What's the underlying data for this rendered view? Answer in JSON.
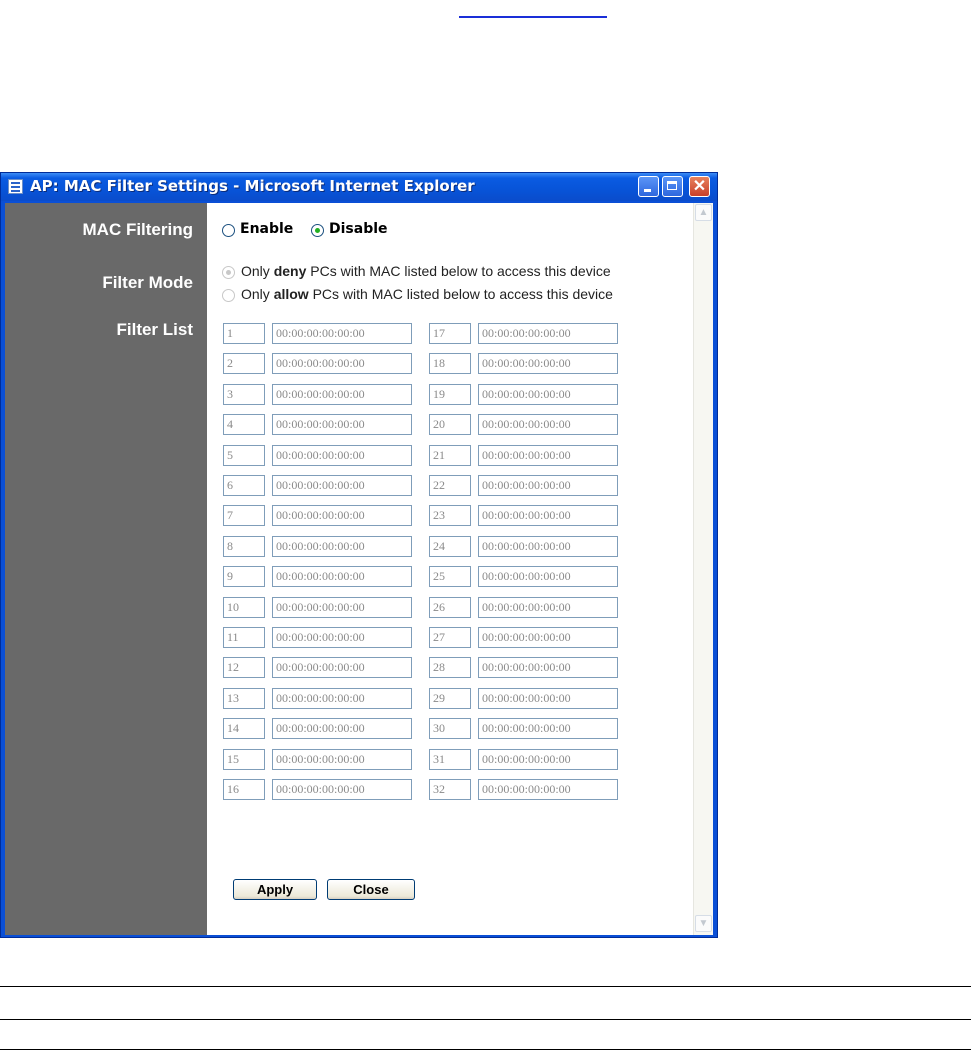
{
  "window": {
    "title": "AP: MAC Filter Settings - Microsoft Internet Explorer",
    "minimize_glyph": "",
    "close_glyph": "✕"
  },
  "labels": {
    "mac_filtering": "MAC Filtering",
    "filter_mode": "Filter Mode",
    "filter_list": "Filter List"
  },
  "mac_filtering": {
    "enable_label": "Enable",
    "disable_label": "Disable",
    "selected": "Disable"
  },
  "filter_mode": {
    "option1_prefix": "Only ",
    "option1_bold": "deny",
    "option1_suffix": " PCs with MAC listed below to access this device",
    "option2_prefix": "Only ",
    "option2_bold": "allow",
    "option2_suffix": " PCs with MAC listed below to access this device",
    "selected": "deny",
    "disabled": true
  },
  "filter_list": [
    {
      "index": "1",
      "mac": "00:00:00:00:00:00"
    },
    {
      "index": "2",
      "mac": "00:00:00:00:00:00"
    },
    {
      "index": "3",
      "mac": "00:00:00:00:00:00"
    },
    {
      "index": "4",
      "mac": "00:00:00:00:00:00"
    },
    {
      "index": "5",
      "mac": "00:00:00:00:00:00"
    },
    {
      "index": "6",
      "mac": "00:00:00:00:00:00"
    },
    {
      "index": "7",
      "mac": "00:00:00:00:00:00"
    },
    {
      "index": "8",
      "mac": "00:00:00:00:00:00"
    },
    {
      "index": "9",
      "mac": "00:00:00:00:00:00"
    },
    {
      "index": "10",
      "mac": "00:00:00:00:00:00"
    },
    {
      "index": "11",
      "mac": "00:00:00:00:00:00"
    },
    {
      "index": "12",
      "mac": "00:00:00:00:00:00"
    },
    {
      "index": "13",
      "mac": "00:00:00:00:00:00"
    },
    {
      "index": "14",
      "mac": "00:00:00:00:00:00"
    },
    {
      "index": "15",
      "mac": "00:00:00:00:00:00"
    },
    {
      "index": "16",
      "mac": "00:00:00:00:00:00"
    },
    {
      "index": "17",
      "mac": "00:00:00:00:00:00"
    },
    {
      "index": "18",
      "mac": "00:00:00:00:00:00"
    },
    {
      "index": "19",
      "mac": "00:00:00:00:00:00"
    },
    {
      "index": "20",
      "mac": "00:00:00:00:00:00"
    },
    {
      "index": "21",
      "mac": "00:00:00:00:00:00"
    },
    {
      "index": "22",
      "mac": "00:00:00:00:00:00"
    },
    {
      "index": "23",
      "mac": "00:00:00:00:00:00"
    },
    {
      "index": "24",
      "mac": "00:00:00:00:00:00"
    },
    {
      "index": "25",
      "mac": "00:00:00:00:00:00"
    },
    {
      "index": "26",
      "mac": "00:00:00:00:00:00"
    },
    {
      "index": "27",
      "mac": "00:00:00:00:00:00"
    },
    {
      "index": "28",
      "mac": "00:00:00:00:00:00"
    },
    {
      "index": "29",
      "mac": "00:00:00:00:00:00"
    },
    {
      "index": "30",
      "mac": "00:00:00:00:00:00"
    },
    {
      "index": "31",
      "mac": "00:00:00:00:00:00"
    },
    {
      "index": "32",
      "mac": "00:00:00:00:00:00"
    }
  ],
  "buttons": {
    "apply": "Apply",
    "close": "Close"
  },
  "colors": {
    "titlebar": "#0a5be2",
    "sidebar": "#696969",
    "field_border": "#7f9db9",
    "field_text": "#8a8a8a"
  },
  "icons": [
    "ie-page-icon",
    "minimize-icon",
    "maximize-icon",
    "close-icon",
    "scroll-up-icon",
    "scroll-down-icon"
  ]
}
